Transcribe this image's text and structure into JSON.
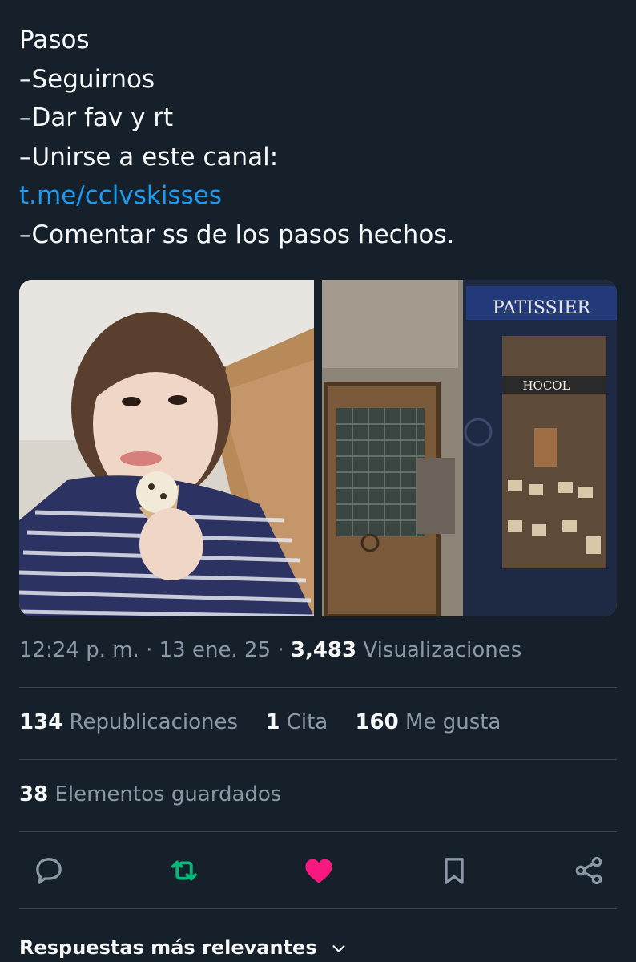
{
  "tweet": {
    "lines": [
      "Pasos",
      "–Seguirnos",
      "–Dar fav y rt",
      "–Unirse a este canal:"
    ],
    "link": "t.me/cclvskisses",
    "last_line": "–Comentar ss de los pasos hechos."
  },
  "media": {
    "shop_sign": "PATISSIER",
    "window_sign": "HOCOL"
  },
  "meta": {
    "time": "12:24 p. m.",
    "sep": "·",
    "date": "13 ene. 25",
    "views_count": "3,483",
    "views_label": "Visualizaciones"
  },
  "stats": {
    "reposts_count": "134",
    "reposts_label": "Republicaciones",
    "quotes_count": "1",
    "quotes_label": "Cita",
    "likes_count": "160",
    "likes_label": "Me gusta"
  },
  "saved": {
    "count": "38",
    "label": "Elementos guardados"
  },
  "actions": {
    "icons": [
      "reply-icon",
      "retweet-icon",
      "like-icon",
      "bookmark-icon",
      "share-icon"
    ],
    "retweet_color": "#00ba7c",
    "like_color": "#f91880",
    "default_color": "#8b98a5"
  },
  "replies": {
    "label": "Respuestas más relevantes"
  }
}
